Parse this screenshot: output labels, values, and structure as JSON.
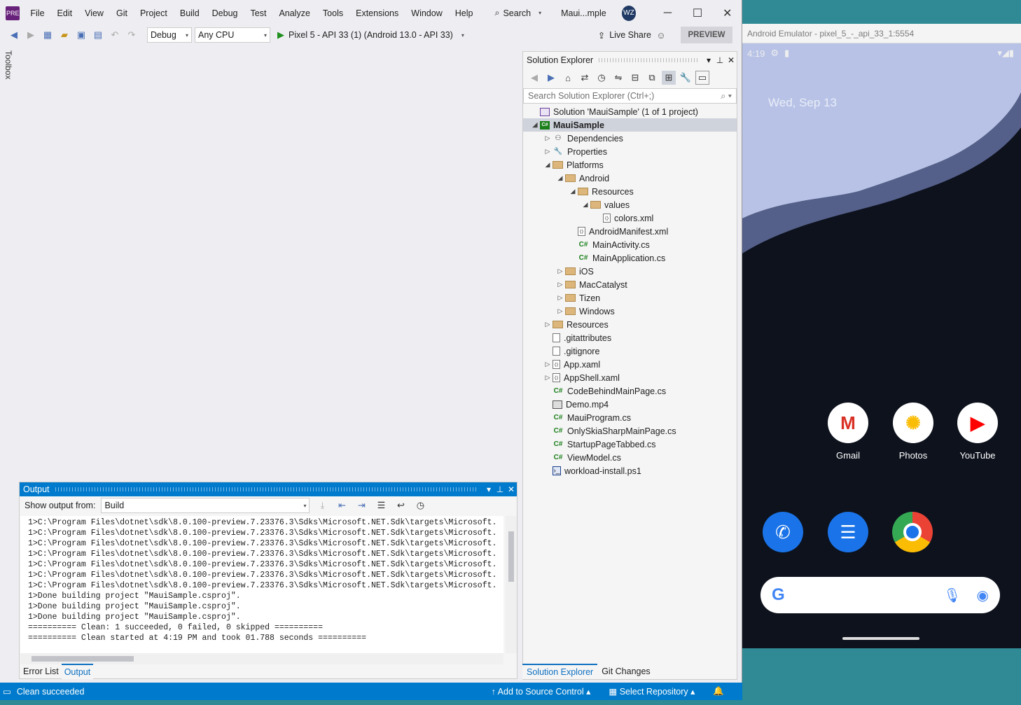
{
  "menu": {
    "logo": "PRE",
    "items": [
      "File",
      "Edit",
      "View",
      "Git",
      "Project",
      "Build",
      "Debug",
      "Test",
      "Analyze",
      "Tools",
      "Extensions",
      "Window",
      "Help"
    ],
    "search_label": "Search",
    "window_title": "Maui...mple",
    "avatar": "WZ"
  },
  "toolbar": {
    "config": "Debug",
    "platform": "Any CPU",
    "run_target": "Pixel 5 - API 33 (1) (Android 13.0 - API 33)",
    "live_share": "Live Share",
    "preview": "PREVIEW"
  },
  "toolbox_label": "Toolbox",
  "solution_explorer": {
    "title": "Solution Explorer",
    "search_placeholder": "Search Solution Explorer (Ctrl+;)",
    "tabs": [
      "Solution Explorer",
      "Git Changes"
    ],
    "tree": [
      {
        "label": "Solution 'MauiSample' (1 of 1 project)",
        "depth": 0,
        "icon": "solution-icon",
        "arrow": ""
      },
      {
        "label": "MauiSample",
        "depth": 0,
        "icon": "csharp-project-icon",
        "arrow": "◢",
        "selected": true
      },
      {
        "label": "Dependencies",
        "depth": 1,
        "icon": "dependencies-icon",
        "arrow": "▷"
      },
      {
        "label": "Properties",
        "depth": 1,
        "icon": "properties-icon",
        "arrow": "▷"
      },
      {
        "label": "Platforms",
        "depth": 1,
        "icon": "folder-icon",
        "arrow": "◢"
      },
      {
        "label": "Android",
        "depth": 2,
        "icon": "folder-icon",
        "arrow": "◢"
      },
      {
        "label": "Resources",
        "depth": 3,
        "icon": "folder-icon",
        "arrow": "◢"
      },
      {
        "label": "values",
        "depth": 4,
        "icon": "folder-icon",
        "arrow": "◢"
      },
      {
        "label": "colors.xml",
        "depth": 5,
        "icon": "xml-file-icon",
        "arrow": ""
      },
      {
        "label": "AndroidManifest.xml",
        "depth": 3,
        "icon": "xml-file-icon",
        "arrow": ""
      },
      {
        "label": "MainActivity.cs",
        "depth": 3,
        "icon": "csharp-file-icon",
        "arrow": ""
      },
      {
        "label": "MainApplication.cs",
        "depth": 3,
        "icon": "csharp-file-icon",
        "arrow": ""
      },
      {
        "label": "iOS",
        "depth": 2,
        "icon": "folder-icon",
        "arrow": "▷"
      },
      {
        "label": "MacCatalyst",
        "depth": 2,
        "icon": "folder-icon",
        "arrow": "▷"
      },
      {
        "label": "Tizen",
        "depth": 2,
        "icon": "folder-icon",
        "arrow": "▷"
      },
      {
        "label": "Windows",
        "depth": 2,
        "icon": "folder-icon",
        "arrow": "▷"
      },
      {
        "label": "Resources",
        "depth": 1,
        "icon": "folder-icon",
        "arrow": "▷"
      },
      {
        "label": ".gitattributes",
        "depth": 1,
        "icon": "text-file-icon",
        "arrow": ""
      },
      {
        "label": ".gitignore",
        "depth": 1,
        "icon": "text-file-icon",
        "arrow": ""
      },
      {
        "label": "App.xaml",
        "depth": 1,
        "icon": "xaml-file-icon",
        "arrow": "▷"
      },
      {
        "label": "AppShell.xaml",
        "depth": 1,
        "icon": "xaml-file-icon",
        "arrow": "▷"
      },
      {
        "label": "CodeBehindMainPage.cs",
        "depth": 1,
        "icon": "csharp-file-icon",
        "arrow": ""
      },
      {
        "label": "Demo.mp4",
        "depth": 1,
        "icon": "media-file-icon",
        "arrow": ""
      },
      {
        "label": "MauiProgram.cs",
        "depth": 1,
        "icon": "csharp-file-icon",
        "arrow": ""
      },
      {
        "label": "OnlySkiaSharpMainPage.cs",
        "depth": 1,
        "icon": "csharp-file-icon",
        "arrow": ""
      },
      {
        "label": "StartupPageTabbed.cs",
        "depth": 1,
        "icon": "csharp-file-icon",
        "arrow": ""
      },
      {
        "label": "ViewModel.cs",
        "depth": 1,
        "icon": "csharp-file-icon",
        "arrow": ""
      },
      {
        "label": "workload-install.ps1",
        "depth": 1,
        "icon": "powershell-file-icon",
        "arrow": ""
      }
    ]
  },
  "output": {
    "title": "Output",
    "show_from_label": "Show output from:",
    "show_from_value": "Build",
    "lines": [
      "1>C:\\Program Files\\dotnet\\sdk\\8.0.100-preview.7.23376.3\\Sdks\\Microsoft.NET.Sdk\\targets\\Microsoft.",
      "1>C:\\Program Files\\dotnet\\sdk\\8.0.100-preview.7.23376.3\\Sdks\\Microsoft.NET.Sdk\\targets\\Microsoft.",
      "1>C:\\Program Files\\dotnet\\sdk\\8.0.100-preview.7.23376.3\\Sdks\\Microsoft.NET.Sdk\\targets\\Microsoft.",
      "1>C:\\Program Files\\dotnet\\sdk\\8.0.100-preview.7.23376.3\\Sdks\\Microsoft.NET.Sdk\\targets\\Microsoft.",
      "1>C:\\Program Files\\dotnet\\sdk\\8.0.100-preview.7.23376.3\\Sdks\\Microsoft.NET.Sdk\\targets\\Microsoft.",
      "1>C:\\Program Files\\dotnet\\sdk\\8.0.100-preview.7.23376.3\\Sdks\\Microsoft.NET.Sdk\\targets\\Microsoft.",
      "1>C:\\Program Files\\dotnet\\sdk\\8.0.100-preview.7.23376.3\\Sdks\\Microsoft.NET.Sdk\\targets\\Microsoft.",
      "1>Done building project \"MauiSample.csproj\".",
      "1>Done building project \"MauiSample.csproj\".",
      "1>Done building project \"MauiSample.csproj\".",
      "========== Clean: 1 succeeded, 0 failed, 0 skipped ==========",
      "========== Clean started at 4:19 PM and took 01.788 seconds =========="
    ],
    "tabs": [
      "Error List",
      "Output"
    ]
  },
  "status": {
    "message": "Clean succeeded",
    "source_control": "Add to Source Control",
    "repository": "Select Repository"
  },
  "emulator": {
    "title": "Android Emulator - pixel_5_-_api_33_1:5554",
    "time": "4:19",
    "date": "Wed, Sep 13",
    "apps": [
      "Gmail",
      "Photos",
      "YouTube"
    ]
  },
  "colors": {
    "accent": "#007acc",
    "vs_bg": "#eeeef2",
    "emulator_bg": "#0d121d",
    "desktop": "#2f8a96"
  }
}
